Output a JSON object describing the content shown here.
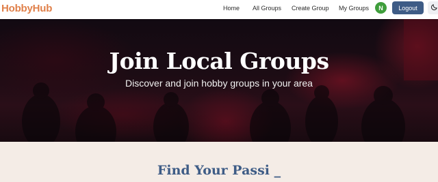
{
  "app": {
    "logo": "HobbyHub"
  },
  "nav": {
    "links": [
      {
        "label": "Home"
      },
      {
        "label": "All Groups"
      },
      {
        "label": "Create Group"
      },
      {
        "label": "My Groups"
      }
    ],
    "avatar_initial": "N",
    "logout_label": "Logout",
    "theme_icon": "moon-icon"
  },
  "hero": {
    "title": "Join Local Groups",
    "subtitle": "Discover and join hobby groups in your area"
  },
  "section": {
    "heading": "Find Your Passi _"
  },
  "colors": {
    "logo": "#e0804a",
    "accent": "#3e5c86",
    "avatar": "#3f9e3c",
    "page_bg": "#f4ece6"
  }
}
